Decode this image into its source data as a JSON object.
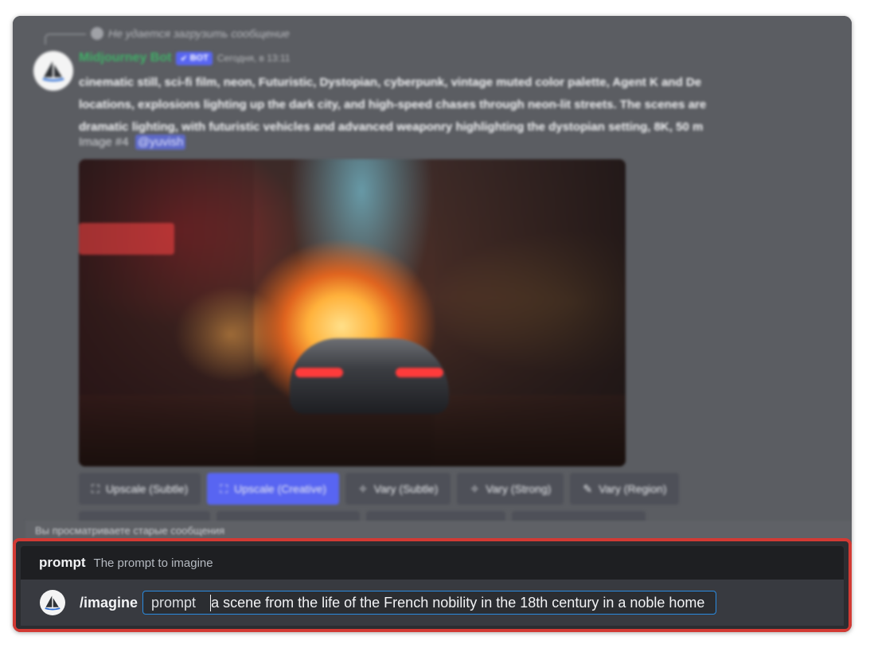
{
  "message": {
    "reply_text": "Не удается загрузить сообщение",
    "author": "Midjourney Bot",
    "badge": "BOT",
    "timestamp": "Сегодня, в 13:11",
    "prompt_lines": [
      "cinematic still, sci-fi film, neon, Futuristic, Dystopian, cyberpunk, vintage muted color palette, Agent K and De",
      "locations, explosions lighting up the dark city, and high-speed chases through neon-lit streets. The scenes are",
      "dramatic lighting, with futuristic vehicles and advanced weaponry highlighting the dystopian setting, 8K, 50 m"
    ],
    "image_label": "Image #4",
    "mention": "@yuvish"
  },
  "buttons": [
    {
      "label": "Upscale (Subtle)",
      "icon": "upscale-icon",
      "primary": false
    },
    {
      "label": "Upscale (Creative)",
      "icon": "upscale-icon",
      "primary": true
    },
    {
      "label": "Vary (Subtle)",
      "icon": "sparkle-icon",
      "primary": false
    },
    {
      "label": "Vary (Strong)",
      "icon": "sparkle-icon",
      "primary": false
    },
    {
      "label": "Vary (Region)",
      "icon": "brush-icon",
      "primary": false
    }
  ],
  "old_messages_notice": "Вы просматриваете старые сообщения",
  "composer": {
    "hint_option": "prompt",
    "hint_description": "The prompt to imagine",
    "command": "/imagine",
    "option_label": "prompt",
    "option_value": "a scene from the life of the French nobility in the 18th century in a noble home"
  },
  "colors": {
    "highlight_border": "#d23a34",
    "bot_name": "#3fb067",
    "accent": "#5865f2",
    "input_focus": "#2a8be0"
  }
}
